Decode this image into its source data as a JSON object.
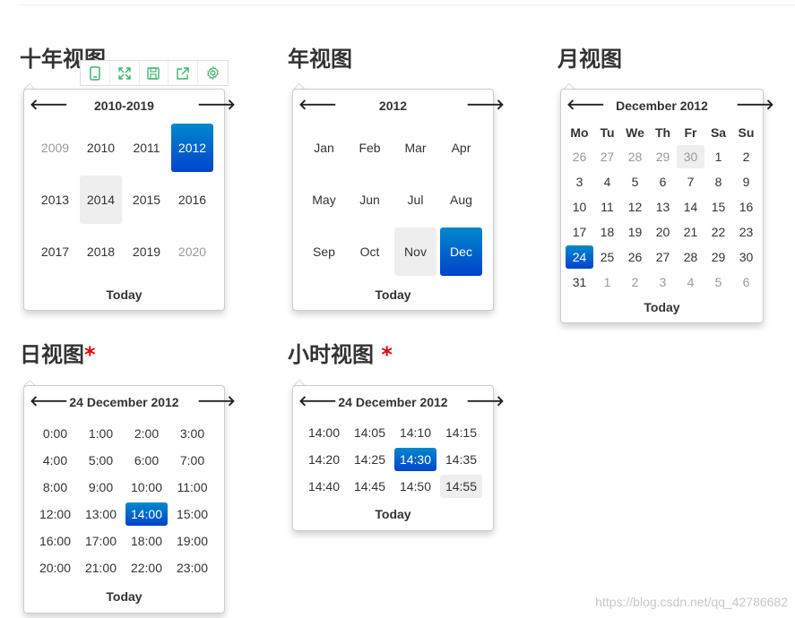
{
  "sections": {
    "decade": {
      "heading": "十年视图"
    },
    "year": {
      "heading": "年视图"
    },
    "month": {
      "heading": "月视图"
    },
    "day": {
      "heading": "日视图",
      "marker": "*"
    },
    "hour": {
      "heading": "小时视图",
      "marker": "*"
    }
  },
  "nav": {
    "prev": "🡐",
    "next": "🡒"
  },
  "decade_view": {
    "title": "2010-2019",
    "cells": [
      "2009",
      "2010",
      "2011",
      "2012",
      "2013",
      "2014",
      "2015",
      "2016",
      "2017",
      "2018",
      "2019",
      "2020"
    ],
    "muted": [
      0,
      11
    ],
    "hover": 5,
    "active": 3,
    "today": "Today"
  },
  "year_view": {
    "title": "2012",
    "cells": [
      "Jan",
      "Feb",
      "Mar",
      "Apr",
      "May",
      "Jun",
      "Jul",
      "Aug",
      "Sep",
      "Oct",
      "Nov",
      "Dec"
    ],
    "hover": 10,
    "active": 11,
    "today": "Today"
  },
  "month_view": {
    "title": "December 2012",
    "dow": [
      "Mo",
      "Tu",
      "We",
      "Th",
      "Fr",
      "Sa",
      "Su"
    ],
    "cells": [
      "26",
      "27",
      "28",
      "29",
      "30",
      "1",
      "2",
      "3",
      "4",
      "5",
      "6",
      "7",
      "8",
      "9",
      "10",
      "11",
      "12",
      "13",
      "14",
      "15",
      "16",
      "17",
      "18",
      "19",
      "20",
      "21",
      "22",
      "23",
      "24",
      "25",
      "26",
      "27",
      "28",
      "29",
      "30",
      "31",
      "1",
      "2",
      "3",
      "4",
      "5",
      "6"
    ],
    "muted": [
      0,
      1,
      2,
      3,
      4,
      36,
      37,
      38,
      39,
      40,
      41
    ],
    "hover": 4,
    "active": 28,
    "today": "Today"
  },
  "day_view": {
    "title": "24 December 2012",
    "cells": [
      "0:00",
      "1:00",
      "2:00",
      "3:00",
      "4:00",
      "5:00",
      "6:00",
      "7:00",
      "8:00",
      "9:00",
      "10:00",
      "11:00",
      "12:00",
      "13:00",
      "14:00",
      "15:00",
      "16:00",
      "17:00",
      "18:00",
      "19:00",
      "20:00",
      "21:00",
      "22:00",
      "23:00"
    ],
    "active": 14,
    "today": "Today"
  },
  "hour_view": {
    "title": "24 December 2012",
    "cells": [
      "14:00",
      "14:05",
      "14:10",
      "14:15",
      "14:20",
      "14:25",
      "14:30",
      "14:35",
      "14:40",
      "14:45",
      "14:50",
      "14:55"
    ],
    "active": 6,
    "hover": 11,
    "today": "Today"
  },
  "toolbar": {
    "icons": [
      "tablet-icon",
      "expand-icon",
      "save-icon",
      "share-icon",
      "settings-icon"
    ],
    "color": "#3cb371"
  },
  "watermark": "https://blog.csdn.net/qq_42786682",
  "colors": {
    "active_top": "#0088cc",
    "active_bottom": "#0044cc",
    "hover": "#eeeeee",
    "required": "#ee0000"
  }
}
